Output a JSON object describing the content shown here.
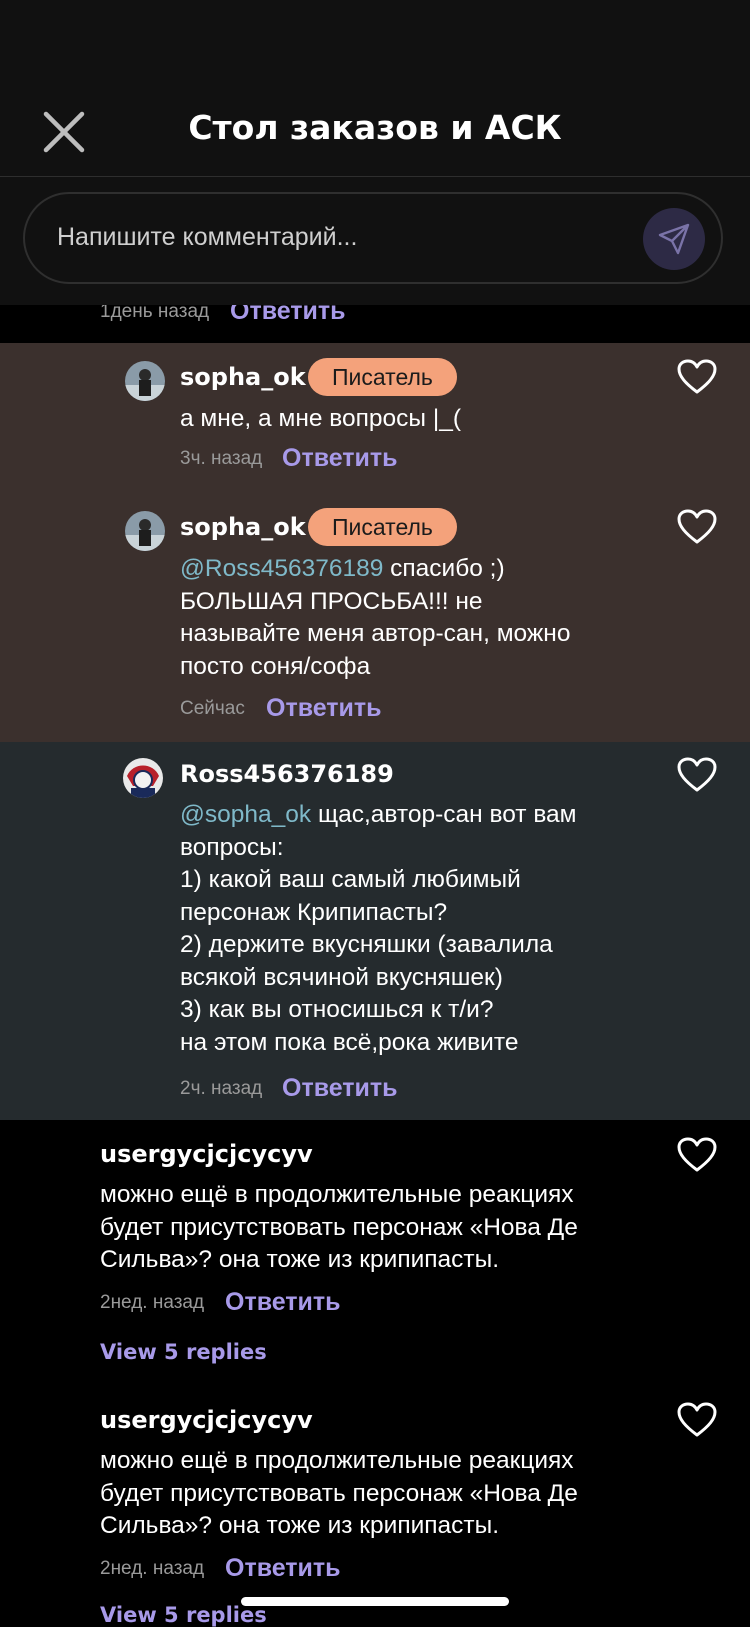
{
  "header": {
    "title": "Стол заказов и АСК",
    "comment_placeholder": "Напишите комментарий..."
  },
  "prev_comment": {
    "time": "1день назад",
    "reply_label": "Ответить"
  },
  "thread": [
    {
      "username": "sopha_ok",
      "badge": "Писатель",
      "text": "а мне, а мне вопросы |_(",
      "time": "3ч. назад",
      "reply_label": "Ответить"
    },
    {
      "username": "sopha_ok",
      "badge": "Писатель",
      "mention": "@Ross456376189",
      "text": " спасибо ;)\nБОЛЬШАЯ ПРОСЬБА!!! не\nназывайте меня автор-сан, можно\nпосто соня/софа",
      "time": "Сейчас",
      "reply_label": "Ответить"
    },
    {
      "username": "Ross456376189",
      "mention": "@sopha_ok",
      "text": " щас,автор-сан вот вам\nвопросы:\n1) какой ваш самый любимый\nперсонаж Крипипасты?\n2) держите вкусняшки (завалила\nвсякой всячиной вкусняшек)\n3) как вы относишься к т/и?\n на этом пока всё,рока живите",
      "time": "2ч. назад",
      "reply_label": "Ответить"
    }
  ],
  "comments": [
    {
      "username": "usergycjcjcycyv",
      "text": "можно ещё в продолжительные реакциях\nбудет присутствовать персонаж «Нова Де\nСильва»? она тоже из крипипасты.",
      "time": "2нед. назад",
      "reply_label": "Ответить",
      "view_replies": "View 5 replies"
    },
    {
      "username": "usergycjcjcycyv",
      "text": "можно ещё в продолжительные реакциях\nбудет присутствовать персонаж «Нова Де\nСильва»? она тоже из крипипасты.",
      "time": "2нед. назад",
      "reply_label": "Ответить",
      "view_replies": "View 5 replies"
    }
  ],
  "colors": {
    "accent": "#a89ae9",
    "mention": "#7fb9c9",
    "badge": "#f4a27b",
    "highlight_a": "#3b302d",
    "highlight_b": "#252b2e"
  }
}
